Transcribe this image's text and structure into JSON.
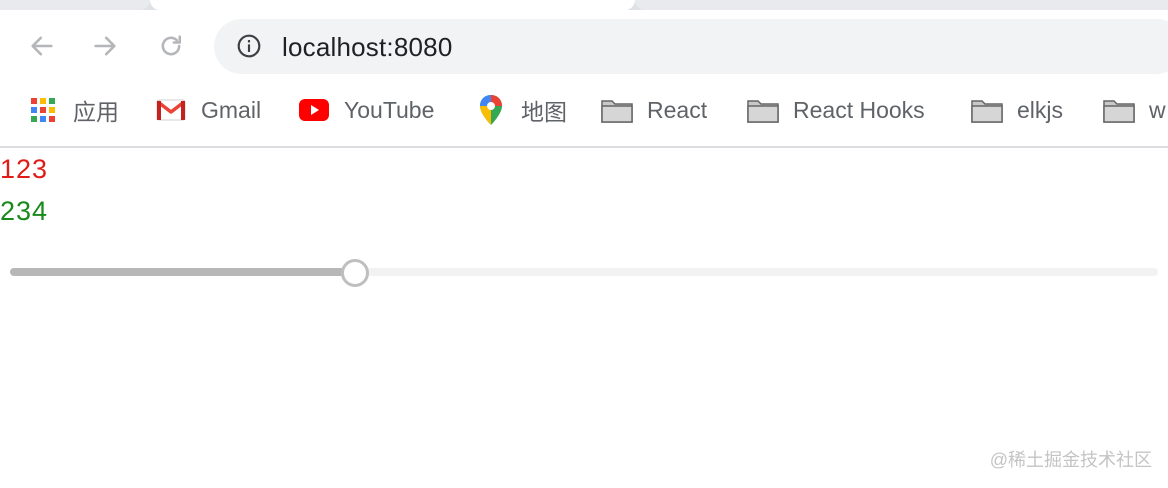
{
  "browser": {
    "url": "localhost:8080",
    "nav": {
      "back_icon": "arrow-left-icon",
      "forward_icon": "arrow-right-icon",
      "reload_icon": "reload-icon",
      "info_icon": "info-circle-icon"
    }
  },
  "bookmarks": [
    {
      "label": "应用",
      "icon": "apps-grid-icon"
    },
    {
      "label": "Gmail",
      "icon": "gmail-icon"
    },
    {
      "label": "YouTube",
      "icon": "youtube-icon"
    },
    {
      "label": "地图",
      "icon": "maps-pin-icon"
    },
    {
      "label": "React",
      "icon": "folder-icon"
    },
    {
      "label": "React Hooks",
      "icon": "folder-icon"
    },
    {
      "label": "elkjs",
      "icon": "folder-icon"
    },
    {
      "label": "w",
      "icon": "folder-icon"
    }
  ],
  "page": {
    "value1": "123",
    "value2": "234",
    "value1_color": "#e11b17",
    "value2_color": "#188a1c",
    "slider": {
      "value_fraction": 0.3
    }
  },
  "watermark": "@稀土掘金技术社区"
}
